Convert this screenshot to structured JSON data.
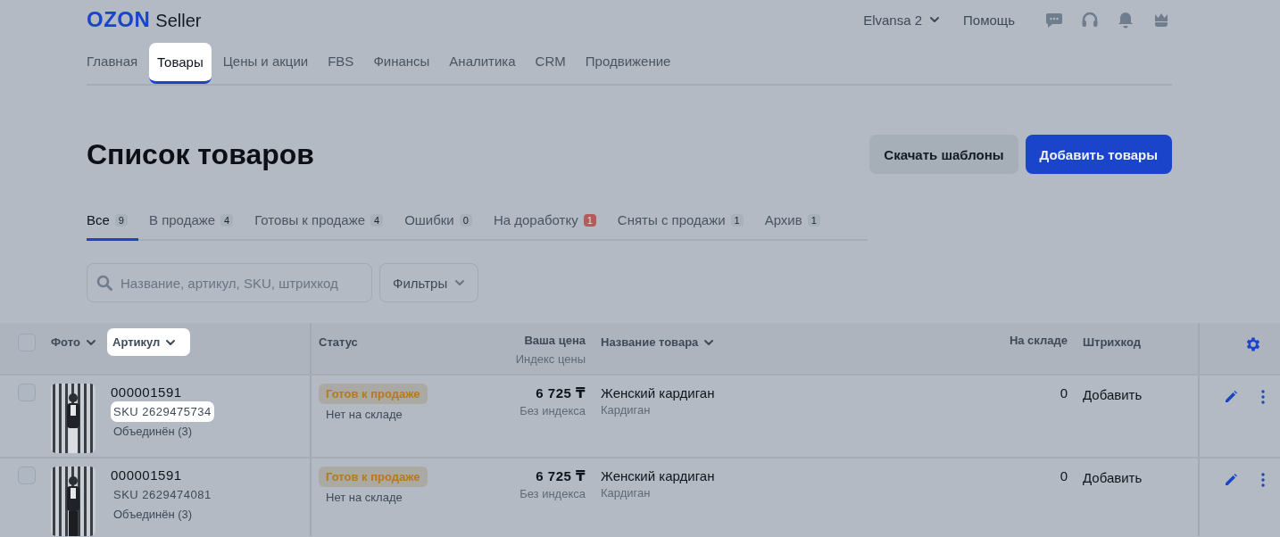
{
  "header": {
    "logo": {
      "brand": "OZON",
      "suffix": "Seller"
    },
    "account": "Elvansa 2",
    "help": "Помощь"
  },
  "nav": [
    {
      "label": "Главная",
      "selected": false,
      "highlighted": false
    },
    {
      "label": "Товары",
      "selected": true,
      "highlighted": true
    },
    {
      "label": "Цены и акции",
      "selected": false,
      "highlighted": false
    },
    {
      "label": "FBS",
      "selected": false,
      "highlighted": false
    },
    {
      "label": "Финансы",
      "selected": false,
      "highlighted": false
    },
    {
      "label": "Аналитика",
      "selected": false,
      "highlighted": false
    },
    {
      "label": "CRM",
      "selected": false,
      "highlighted": false
    },
    {
      "label": "Продвижение",
      "selected": false,
      "highlighted": false
    }
  ],
  "page_title": "Список товаров",
  "actions": [
    {
      "label": "Скачать шаблоны",
      "kind": "secondary"
    },
    {
      "label": "Добавить товары",
      "kind": "primary"
    }
  ],
  "status_tabs": [
    {
      "label": "Все",
      "count": "9",
      "selected": true,
      "alert": false
    },
    {
      "label": "В продаже",
      "count": "4",
      "selected": false,
      "alert": false
    },
    {
      "label": "Готовы к продаже",
      "count": "4",
      "selected": false,
      "alert": false
    },
    {
      "label": "Ошибки",
      "count": "0",
      "selected": false,
      "alert": false
    },
    {
      "label": "На доработку",
      "count": "1",
      "selected": false,
      "alert": true
    },
    {
      "label": "Сняты с продажи",
      "count": "1",
      "selected": false,
      "alert": false
    },
    {
      "label": "Архив",
      "count": "1",
      "selected": false,
      "alert": false
    }
  ],
  "search": {
    "placeholder": "Название, артикул, SKU, штрихкод"
  },
  "filters": {
    "label": "Фильтры"
  },
  "table": {
    "select_all": {
      "checked": false
    },
    "columns": [
      {
        "label": "Фото",
        "sortable": true,
        "highlighted": false
      },
      {
        "label": "Артикул",
        "sortable": true,
        "highlighted": true
      },
      {
        "label": "Статус",
        "sortable": false,
        "highlighted": false
      },
      {
        "label": "Ваша цена",
        "sublabel": "Индекс цены",
        "sortable": false,
        "highlighted": false
      },
      {
        "label": "Название товара",
        "sortable": true,
        "highlighted": false
      },
      {
        "label": "На складе",
        "sortable": false,
        "highlighted": false
      },
      {
        "label": "Штрихкод",
        "sortable": false,
        "highlighted": false
      }
    ],
    "rows": [
      {
        "checked": false,
        "article": "000001591",
        "sku": "SKU 2629475734",
        "sku_highlighted": true,
        "merged": "Объединён (3)",
        "status": "Готов к продаже",
        "stock_note": "Нет на складе",
        "price": "6 725 ₸",
        "price_index": "Без индекса",
        "name": "Женский кардиган",
        "category": "Кардиган",
        "stock": "0",
        "barcode": "Добавить"
      },
      {
        "checked": false,
        "article": "000001591",
        "sku": "SKU 2629474081",
        "sku_highlighted": false,
        "merged": "Объединён (3)",
        "status": "Готов к продаже",
        "stock_note": "Нет на складе",
        "price": "6 725 ₸",
        "price_index": "Без индекса",
        "name": "Женский кардиган",
        "category": "Кардиган",
        "stock": "0",
        "barcode": "Добавить"
      }
    ]
  }
}
